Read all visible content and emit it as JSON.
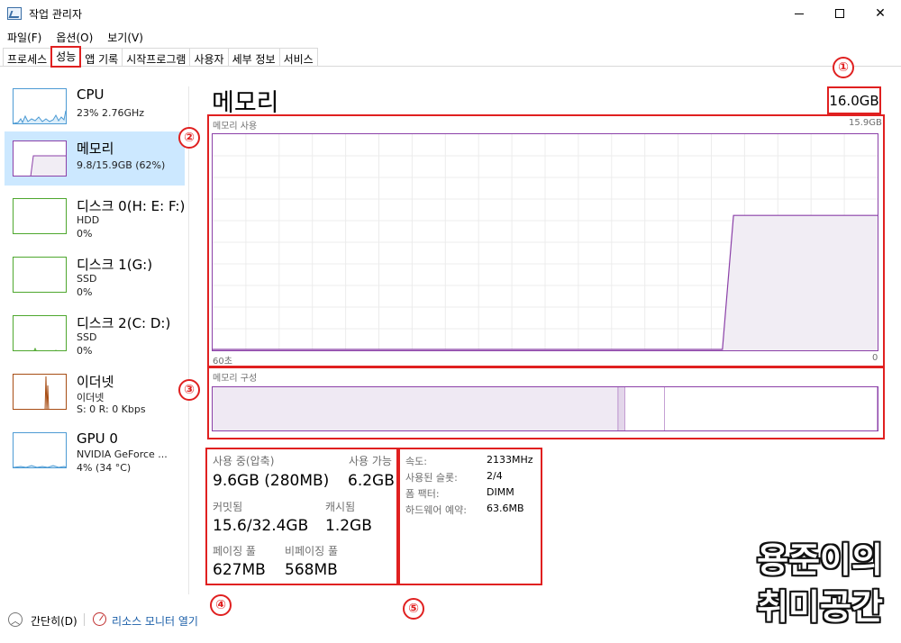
{
  "window": {
    "title": "작업 관리자"
  },
  "menu": [
    {
      "label": "파일(F)"
    },
    {
      "label": "옵션(O)"
    },
    {
      "label": "보기(V)"
    }
  ],
  "tabs": [
    {
      "label": "프로세스"
    },
    {
      "label": "성능",
      "active": true
    },
    {
      "label": "앱 기록"
    },
    {
      "label": "시작프로그램"
    },
    {
      "label": "사용자"
    },
    {
      "label": "세부 정보"
    },
    {
      "label": "서비스"
    }
  ],
  "sidebar": {
    "items": [
      {
        "title": "CPU",
        "line1": "23% 2.76GHz",
        "line2": ""
      },
      {
        "title": "메모리",
        "line1": "9.8/15.9GB (62%)",
        "line2": "",
        "selected": true
      },
      {
        "title": "디스크 0(H: E: F:)",
        "line1": "HDD",
        "line2": "0%"
      },
      {
        "title": "디스크 1(G:)",
        "line1": "SSD",
        "line2": "0%"
      },
      {
        "title": "디스크 2(C: D:)",
        "line1": "SSD",
        "line2": "0%"
      },
      {
        "title": "이더넷",
        "line1": "이더넷",
        "line2": "S: 0 R: 0 Kbps"
      },
      {
        "title": "GPU 0",
        "line1": "NVIDIA GeForce ...",
        "line2": "4% (34 °C)"
      }
    ]
  },
  "main": {
    "title": "메모리",
    "total": "16.0GB",
    "usage_chart": {
      "label": "메모리 사용",
      "max_label": "15.9GB",
      "time_left": "60초",
      "time_right": "0",
      "values_pct": [
        0,
        0,
        0,
        0,
        0,
        0,
        0,
        0,
        0,
        0,
        0,
        0,
        0,
        0,
        0,
        0,
        0,
        0,
        0,
        0,
        0,
        0,
        0,
        0,
        0,
        0,
        0,
        0,
        0,
        0,
        0,
        0,
        0,
        0,
        0,
        0,
        0,
        0,
        0,
        0,
        0,
        0,
        0,
        0,
        0,
        0,
        0,
        62,
        62,
        62,
        62,
        62,
        62,
        62,
        62,
        62,
        62,
        62,
        62,
        62,
        62
      ]
    },
    "composition": {
      "label": "메모리 구성",
      "in_use_pct": 61,
      "modified_pct": 1,
      "standby_pct": 6,
      "free_pct": 32
    },
    "stats": {
      "in_use_label": "사용 중(압축)",
      "in_use_value": "9.6GB (280MB)",
      "available_label": "사용 가능",
      "available_value": "6.2GB",
      "committed_label": "커밋됨",
      "committed_value": "15.6/32.4GB",
      "cached_label": "캐시됨",
      "cached_value": "1.2GB",
      "paged_label": "페이징 풀",
      "paged_value": "627MB",
      "nonpaged_label": "비페이징 풀",
      "nonpaged_value": "568MB"
    },
    "specs": [
      {
        "label": "속도:",
        "value": "2133MHz"
      },
      {
        "label": "사용된 슬롯:",
        "value": "2/4"
      },
      {
        "label": "폼 팩터:",
        "value": "DIMM"
      },
      {
        "label": "하드웨어 예약:",
        "value": "63.6MB"
      }
    ]
  },
  "callouts": [
    "①",
    "②",
    "③",
    "④",
    "⑤"
  ],
  "footer": {
    "collapse_label": "간단히(D)",
    "resource_monitor_label": "리소스 모니터 열기"
  },
  "watermark": {
    "line1": "용준이의",
    "line2": "취미공간"
  },
  "colors": {
    "memory_purple": "#8b40a8",
    "memory_fill": "#f1edf4",
    "cpu_blue": "#4d9bd4",
    "disk_green": "#4ea72e",
    "ethernet_orange": "#a74d14",
    "highlight_red": "#e02020",
    "selected_bg": "#cce8ff"
  }
}
